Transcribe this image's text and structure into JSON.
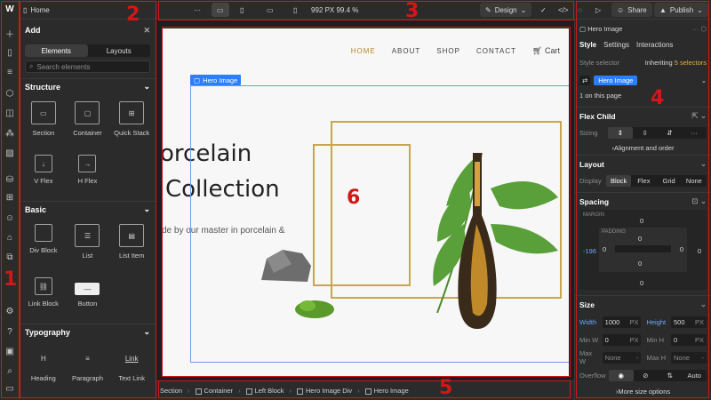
{
  "app": {
    "page_tab": "Home",
    "more_label": "···",
    "canvas_size": "992 PX 99.4 %",
    "design_label": "Design",
    "share_label": "Share",
    "publish_label": "Publish"
  },
  "add_panel": {
    "title": "Add",
    "tabs": [
      "Elements",
      "Layouts"
    ],
    "search_placeholder": "Search elements",
    "structure_title": "Structure",
    "structure_items": [
      "Section",
      "Container",
      "Quick Stack",
      "V Flex",
      "H Flex"
    ],
    "basic_title": "Basic",
    "basic_items": [
      "Div Block",
      "List",
      "List Item",
      "Link Block",
      "Button"
    ],
    "typography_title": "Typography",
    "typography_items": [
      "Heading",
      "Paragraph",
      "Text Link"
    ]
  },
  "canvas": {
    "nav": [
      "HOME",
      "ABOUT",
      "SHOP",
      "CONTACT"
    ],
    "cart": "Cart",
    "selected_label": "Hero Image",
    "headline_1": "orcelain",
    "headline_2": "Collection",
    "subtext": "de by our master in porcelain &"
  },
  "breadcrumbs": [
    "Section",
    "Container",
    "Left Block",
    "Hero Image Div",
    "Hero Image"
  ],
  "style_panel": {
    "element": "Hero Image",
    "tabs": [
      "Style",
      "Settings",
      "Interactions"
    ],
    "selector_label": "Style selector",
    "inheriting": "Inheriting",
    "selectors_count": "5 selectors",
    "selector_tag": "Hero Image",
    "on_page": "1 on this page",
    "flex_child_title": "Flex Child",
    "sizing_label": "Sizing",
    "align_order": "Alignment and order",
    "layout_title": "Layout",
    "display_label": "Display",
    "display_options": [
      "Block",
      "Flex",
      "Grid",
      "None"
    ],
    "spacing_title": "Spacing",
    "margin_label": "MARGIN",
    "padding_label": "PADDING",
    "margin_left": "-196",
    "zero": "0",
    "size_title": "Size",
    "width_label": "Width",
    "width_value": "1000",
    "height_label": "Height",
    "height_value": "500",
    "unit": "PX",
    "min_w_label": "Min W",
    "min_h_label": "Min H",
    "max_w_label": "Max W",
    "max_h_label": "Max H",
    "none_value": "None",
    "overflow_label": "Overflow",
    "auto_value": "Auto",
    "more_size": "More size options"
  },
  "annotations": [
    "1",
    "2",
    "3",
    "4",
    "5",
    "6"
  ],
  "colors": {
    "accent_blue": "#2b7fff",
    "annotation_red": "#d01818",
    "gold": "#c9a64e"
  }
}
